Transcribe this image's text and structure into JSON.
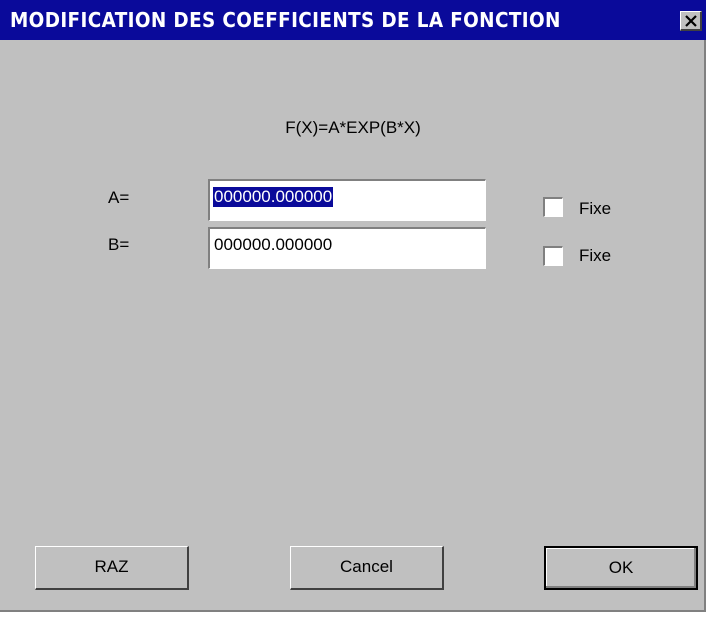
{
  "window": {
    "title": "MODIFICATION DES COEFFICIENTS DE LA FONCTION",
    "close_icon": "close-x-icon"
  },
  "formula": "F(X)=A*EXP(B*X)",
  "fields": [
    {
      "label": "A=",
      "value": "000000.000000",
      "selected": true,
      "fixed_label": "Fixe",
      "fixed_checked": false
    },
    {
      "label": "B=",
      "value": "000000.000000",
      "selected": false,
      "fixed_label": "Fixe",
      "fixed_checked": false
    }
  ],
  "buttons": {
    "reset_label": "RAZ",
    "cancel_label": "Cancel",
    "ok_label": "OK"
  },
  "colors": {
    "title_bar": "#0a0a9a",
    "dialog_bg": "#c0c0c0",
    "selection": "#0a0a9a"
  }
}
